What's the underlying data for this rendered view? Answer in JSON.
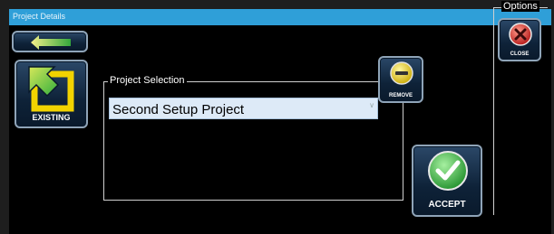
{
  "window": {
    "title": "Project Details"
  },
  "toolbar": {
    "back_icon": "back-arrow-icon"
  },
  "existing": {
    "label": "EXISTING",
    "icon": "existing-project-icon"
  },
  "project_selection": {
    "legend": "Project Selection",
    "items": [
      {
        "label": "Second Setup Project",
        "selected": true
      }
    ]
  },
  "remove": {
    "label": "REMOVE",
    "icon": "remove-icon"
  },
  "accept": {
    "label": "ACCEPT",
    "icon": "checkmark-icon"
  },
  "options": {
    "legend": "Options",
    "close_label": "CLOSE",
    "close_icon": "close-icon"
  },
  "colors": {
    "titlebar": "#2f9fd8",
    "accent_yellow": "#f2d300",
    "accept_green": "#3db83d",
    "close_red": "#d92b2b"
  }
}
